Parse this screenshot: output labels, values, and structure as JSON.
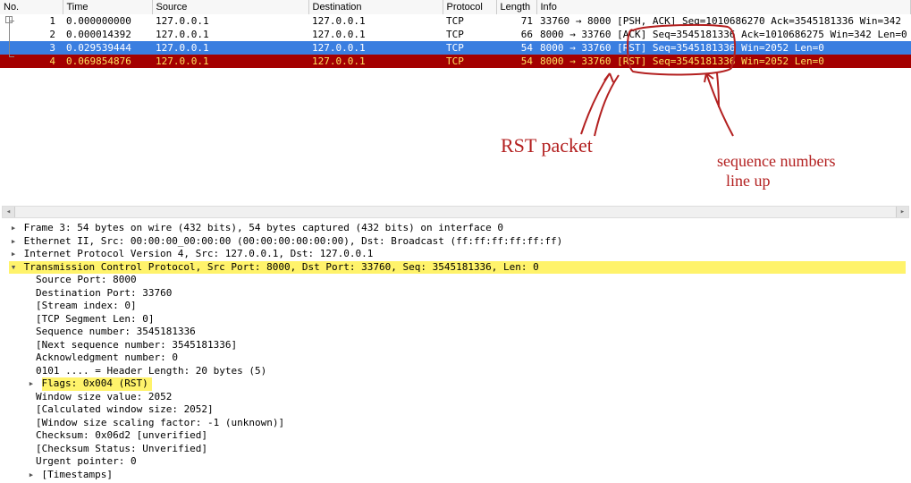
{
  "columns": {
    "no": "No.",
    "time": "Time",
    "src": "Source",
    "dst": "Destination",
    "proto": "Protocol",
    "len": "Length",
    "info": "Info"
  },
  "packets": [
    {
      "no": "1",
      "time": "0.000000000",
      "src": "127.0.0.1",
      "dst": "127.0.0.1",
      "proto": "TCP",
      "len": "71",
      "info": "33760 → 8000 [PSH, ACK] Seq=1010686270 Ack=3545181336 Win=342"
    },
    {
      "no": "2",
      "time": "0.000014392",
      "src": "127.0.0.1",
      "dst": "127.0.0.1",
      "proto": "TCP",
      "len": "66",
      "info": "8000 → 33760 [ACK] Seq=3545181336 Ack=1010686275 Win=342 Len=0"
    },
    {
      "no": "3",
      "time": "0.029539444",
      "src": "127.0.0.1",
      "dst": "127.0.0.1",
      "proto": "TCP",
      "len": "54",
      "info": "8000 → 33760 [RST] Seq=3545181336 Win=2052 Len=0"
    },
    {
      "no": "4",
      "time": "0.069854876",
      "src": "127.0.0.1",
      "dst": "127.0.0.1",
      "proto": "TCP",
      "len": "54",
      "info": "8000 → 33760 [RST] Seq=3545181336 Win=2052 Len=0"
    }
  ],
  "details": {
    "frame": "Frame 3: 54 bytes on wire (432 bits), 54 bytes captured (432 bits) on interface 0",
    "eth": "Ethernet II, Src: 00:00:00_00:00:00 (00:00:00:00:00:00), Dst: Broadcast (ff:ff:ff:ff:ff:ff)",
    "ip": "Internet Protocol Version 4, Src: 127.0.0.1, Dst: 127.0.0.1",
    "tcp": "Transmission Control Protocol, Src Port: 8000, Dst Port: 33760, Seq: 3545181336, Len: 0",
    "srcport": "Source Port: 8000",
    "dstport": "Destination Port: 33760",
    "stream": "[Stream index: 0]",
    "seglen": "[TCP Segment Len: 0]",
    "seq": "Sequence number: 3545181336",
    "nextseq": "[Next sequence number: 3545181336]",
    "ack": "Acknowledgment number: 0",
    "hdrlen": "0101 .... = Header Length: 20 bytes (5)",
    "flags": "Flags: 0x004 (RST)",
    "winsize": "Window size value: 2052",
    "calcwin": "[Calculated window size: 2052]",
    "winscale": "[Window size scaling factor: -1 (unknown)]",
    "checksum": "Checksum: 0x06d2 [unverified]",
    "checkstat": "[Checksum Status: Unverified]",
    "urgent": "Urgent pointer: 0",
    "timestamps": "[Timestamps]"
  },
  "annotations": {
    "rst_label": "RST packet",
    "seq_label1": "sequence numbers",
    "seq_label2": "line up"
  }
}
